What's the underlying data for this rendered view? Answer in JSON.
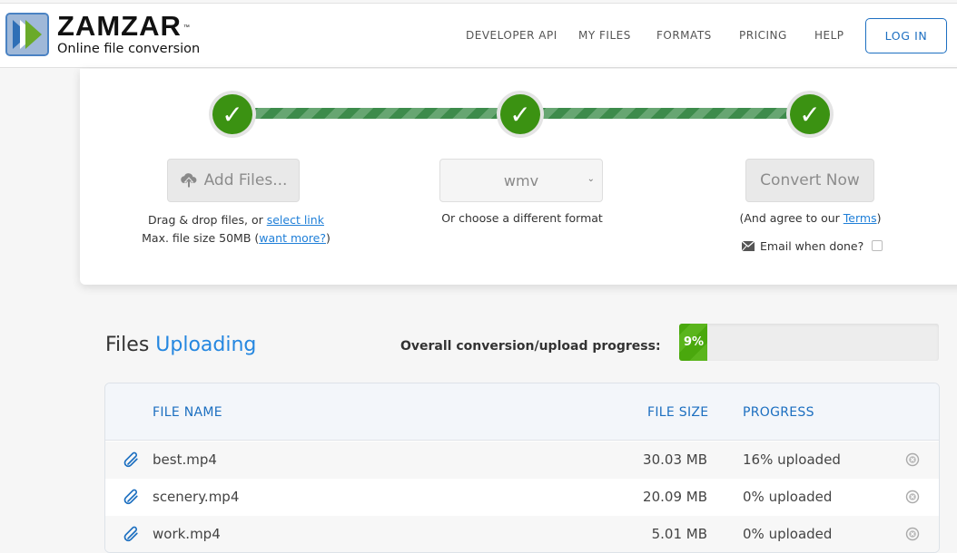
{
  "brand": {
    "name": "ZAMZAR",
    "trademark": "™",
    "tagline": "Online file conversion",
    "colors": {
      "primary_blue": "#1d6fc1",
      "green": "#3b9212",
      "accent_blue": "#2587e0"
    }
  },
  "nav": {
    "items": [
      {
        "label": "DEVELOPER API"
      },
      {
        "label": "MY FILES"
      },
      {
        "label": "FORMATS"
      },
      {
        "label": "PRICING"
      },
      {
        "label": "HELP"
      }
    ],
    "login_label": "LOG IN"
  },
  "steps": {
    "step1_icon": "✓",
    "step2_icon": "✓",
    "step3_icon": "✓",
    "add_files_label": "Add Files...",
    "drag_text": "Drag & drop files, or ",
    "select_link": "select link",
    "max_size_text": "Max. file size 50MB (",
    "want_more_link": "want more?",
    "max_size_close": ")",
    "format_selected": "wmv",
    "format_helper": "Or choose a different format",
    "convert_label": "Convert Now",
    "terms_prefix": "(And agree to our ",
    "terms_link": "Terms",
    "terms_suffix": ")",
    "email_label": "Email when done?",
    "email_checked": false
  },
  "files": {
    "title_plain": "Files ",
    "title_accent": "Uploading",
    "overall_label": "Overall conversion/upload progress:",
    "overall_progress_percent": 9,
    "overall_progress_text": "9%",
    "columns": {
      "name": "FILE NAME",
      "size": "FILE SIZE",
      "progress": "PROGRESS"
    },
    "rows": [
      {
        "name": "best.mp4",
        "size": "30.03 MB",
        "progress": "16% uploaded"
      },
      {
        "name": "scenery.mp4",
        "size": "20.09 MB",
        "progress": "0% uploaded"
      },
      {
        "name": "work.mp4",
        "size": "5.01 MB",
        "progress": "0% uploaded"
      }
    ]
  }
}
